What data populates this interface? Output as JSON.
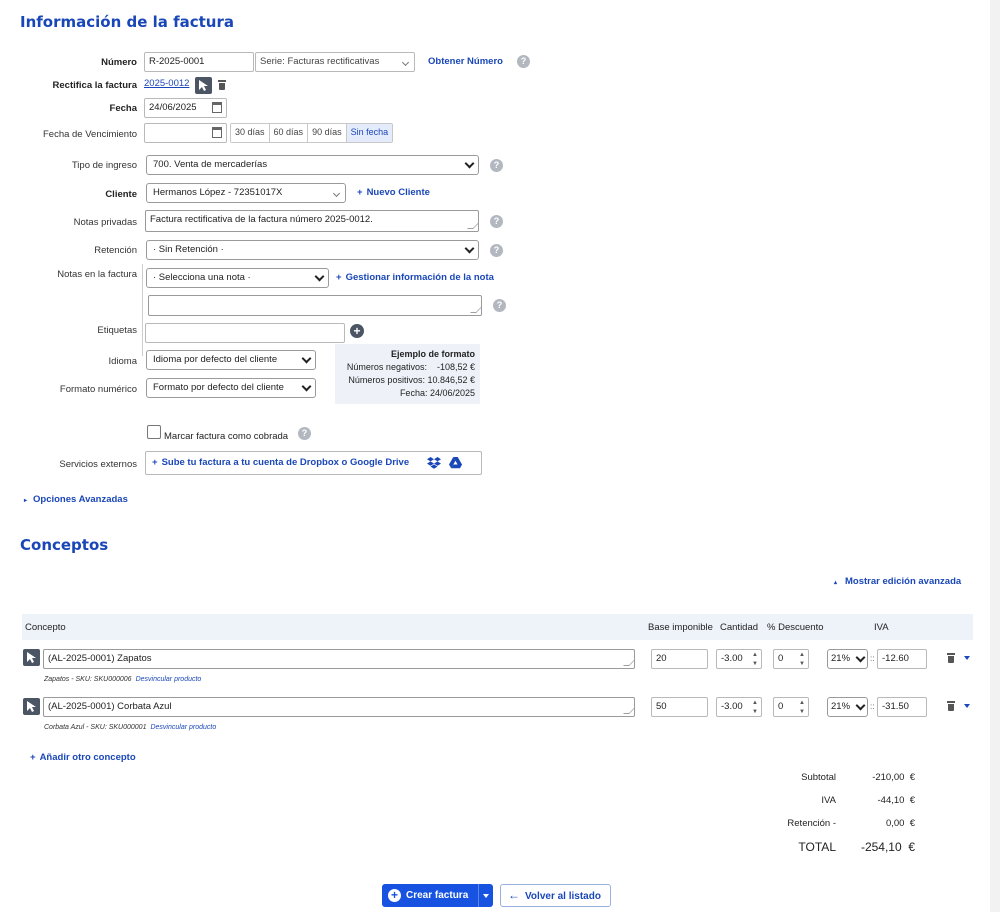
{
  "header": {
    "title": "Información de la factura"
  },
  "form": {
    "numero": {
      "label": "Número",
      "value": "R-2025-0001",
      "serie": "Serie: Facturas rectificativas",
      "obtener": "Obtener Número"
    },
    "rectifica": {
      "label": "Rectifica la factura",
      "link": "2025-0012"
    },
    "fecha": {
      "label": "Fecha",
      "value": "24/06/2025"
    },
    "vencimiento": {
      "label": "Fecha de Vencimiento",
      "value": "",
      "options": [
        "30 días",
        "60 días",
        "90 días",
        "Sin fecha"
      ],
      "active": "Sin fecha"
    },
    "tipo_ingreso": {
      "label": "Tipo de ingreso",
      "value": "700. Venta de mercaderías"
    },
    "cliente": {
      "label": "Cliente",
      "value": "Hermanos López - 72351017X",
      "nuevo": "Nuevo Cliente"
    },
    "notas_privadas": {
      "label": "Notas privadas",
      "value": "Factura rectificativa de la factura número 2025-0012."
    },
    "retencion": {
      "label": "Retención",
      "value": "· Sin Retención ·"
    },
    "notas_factura": {
      "label": "Notas en la factura",
      "select": "· Selecciona una nota ·",
      "gestionar": "Gestionar información de la nota",
      "text": ""
    },
    "etiquetas": {
      "label": "Etiquetas",
      "value": ""
    },
    "idioma": {
      "label": "Idioma",
      "value": "Idioma por defecto del cliente"
    },
    "formato": {
      "label": "Formato numérico",
      "value": "Formato por defecto del cliente"
    },
    "ejemplo": {
      "title": "Ejemplo de formato",
      "neg": "Números negativos:    -108,52 €",
      "pos": "Números positivos: 10.846,52 €",
      "fecha": "Fecha: 24/06/2025"
    },
    "cobrada": {
      "label": "Marcar factura como cobrada",
      "checked": false
    },
    "servicios": {
      "label": "Servicios externos",
      "button": "Sube tu factura a tu cuenta de Dropbox o Google Drive"
    },
    "avanzadas": "Opciones Avanzadas"
  },
  "conceptos": {
    "title": "Conceptos",
    "toggle": "Mostrar edición avanzada",
    "headers": {
      "concepto": "Concepto",
      "base": "Base imponible",
      "cantidad": "Cantidad",
      "descuento": "% Descuento",
      "iva": "IVA"
    },
    "rows": [
      {
        "concepto": "(AL-2025-0001) Zapatos",
        "sub": "Zapatos - SKU: SKU000006",
        "desvincular": "Desvincular producto",
        "base": "20",
        "cantidad": "-3.00",
        "descuento": "0",
        "iva": "21%",
        "iva_sep": "::",
        "iva_amount": "-12.60"
      },
      {
        "concepto": "(AL-2025-0001) Corbata Azul",
        "sub": "Corbata Azul - SKU: SKU000001",
        "desvincular": "Desvincular producto",
        "base": "50",
        "cantidad": "-3.00",
        "descuento": "0",
        "iva": "21%",
        "iva_sep": "::",
        "iva_amount": "-31.50"
      }
    ],
    "add": "Añadir otro concepto"
  },
  "totals": {
    "subtotal_label": "Subtotal",
    "subtotal": "-210,00  €",
    "iva_label": "IVA",
    "iva": "-44,10  €",
    "retencion_label": "Retención -",
    "retencion": "0,00  €",
    "total_label": "TOTAL",
    "total": "-254,10  €"
  },
  "actions": {
    "crear": "Crear factura",
    "volver": "Volver al listado"
  },
  "colors": {
    "accent": "#1a47b8",
    "primary_button": "#1753e0"
  }
}
